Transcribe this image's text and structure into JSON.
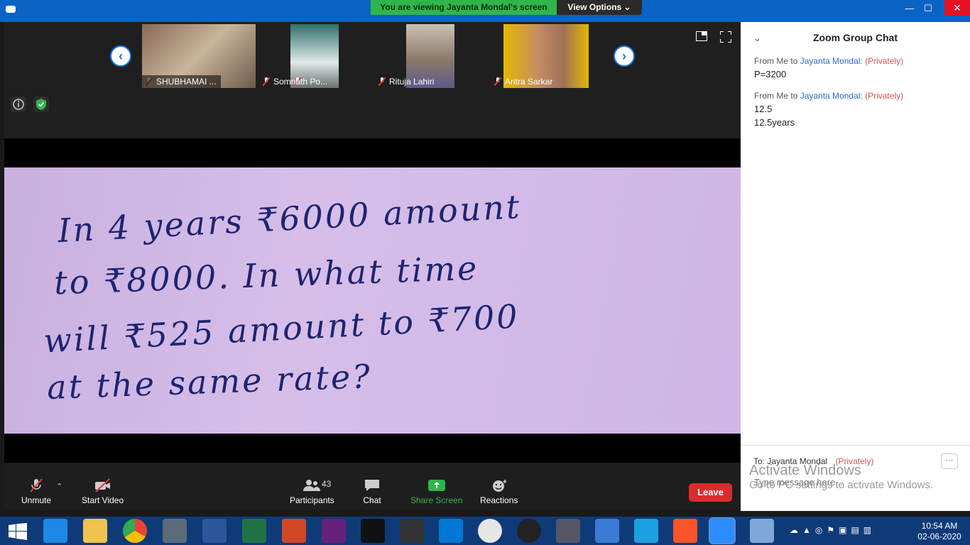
{
  "window": {
    "banner": "You are viewing Jayanta Mondal's screen",
    "view_options": "View Options ⌄",
    "controls": {
      "minimize": "—",
      "maximize": "☐",
      "close": "✕"
    }
  },
  "participants_strip": [
    {
      "name": "SHUBHAMAI ..."
    },
    {
      "name": "Somnath Po..."
    },
    {
      "name": "Rituja Lahiri"
    },
    {
      "name": "Aritra Sarkar"
    }
  ],
  "shared_content": {
    "lines": [
      "In 4 years ₹6000 amount",
      "to ₹8000. In what time",
      "will ₹525 amount to ₹700",
      "at the same rate?"
    ]
  },
  "toolbar": {
    "unmute": "Unmute",
    "start_video": "Start Video",
    "participants": "Participants",
    "participants_count": "43",
    "chat": "Chat",
    "share_screen": "Share Screen",
    "reactions": "Reactions",
    "leave": "Leave"
  },
  "chat": {
    "title": "Zoom Group Chat",
    "messages": [
      {
        "from": "From Me to",
        "to": "Jayanta Mondal:",
        "privacy": "(Privately)",
        "lines": [
          "P=3200"
        ]
      },
      {
        "from": "From Me to",
        "to": "Jayanta Mondal:",
        "privacy": "(Privately)",
        "lines": [
          "12.5",
          "12.5years"
        ]
      }
    ],
    "recipient_prefix": "To:",
    "recipient": "Jayanta Mondal",
    "recipient_privacy": "(Privately)",
    "input_placeholder": "Type message here...",
    "more": "···"
  },
  "watermark": {
    "title": "Activate Windows",
    "subtitle": "Go to PC settings to activate Windows."
  },
  "taskbar": {
    "time": "10:54 AM",
    "date": "02-06-2020"
  },
  "colors": {
    "titlebar": "#0b63c4",
    "banner": "#2fb64b",
    "leave": "#d92d2d",
    "share_screen": "#2fb64b",
    "chat_link": "#2d6ac5",
    "private": "#d9534f"
  }
}
